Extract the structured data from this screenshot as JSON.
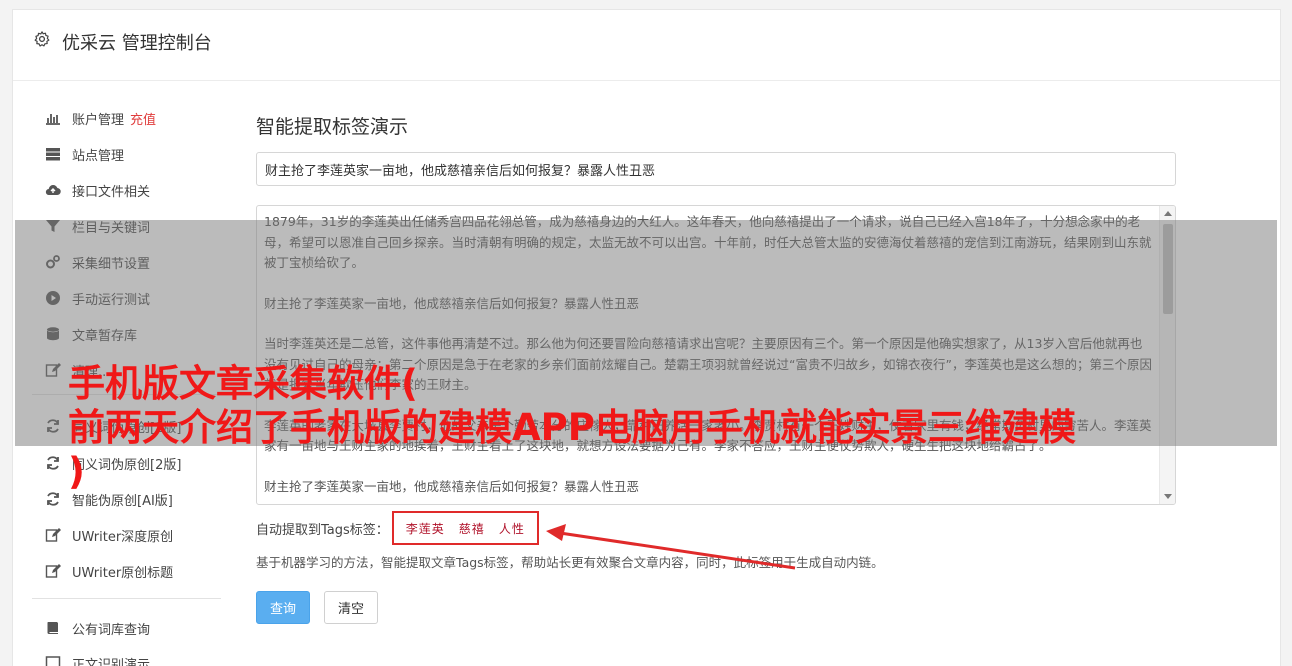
{
  "header": {
    "title": "优采云 管理控制台",
    "icon": "gear-icon"
  },
  "sidebar": {
    "items": [
      {
        "label": "账户管理",
        "badge": "充值",
        "icon": "bar-chart-icon"
      },
      {
        "label": "站点管理",
        "icon": "server-icon"
      },
      {
        "label": "接口文件相关",
        "icon": "cloud-upload-icon"
      },
      {
        "label": "栏目与关键词",
        "icon": "filter-icon"
      },
      {
        "label": "采集细节设置",
        "icon": "gears-icon"
      },
      {
        "label": "手动运行测试",
        "icon": "play-circle-icon"
      },
      {
        "label": "文章暂存库",
        "icon": "database-icon"
      },
      {
        "label": "清理...",
        "icon": "edit-icon"
      },
      {
        "label": "同义词伪原创[1版]",
        "icon": "refresh-icon"
      },
      {
        "label": "同义词伪原创[2版]",
        "icon": "refresh-icon"
      },
      {
        "label": "智能伪原创[AI版]",
        "icon": "refresh-icon"
      },
      {
        "label": "UWriter深度原创",
        "icon": "edit-icon"
      },
      {
        "label": "UWriter原创标题",
        "icon": "edit-icon"
      },
      {
        "label": "公有词库查询",
        "icon": "book-icon"
      },
      {
        "label": "正文识别演示",
        "icon": "window-icon"
      }
    ]
  },
  "main": {
    "title": "智能提取标签演示",
    "title_input_value": "财主抢了李莲英家一亩地，他成慈禧亲信后如何报复？暴露人性丑恶",
    "content_paragraphs": [
      "1879年，31岁的李莲英出任储秀宫四品花翎总管，成为慈禧身边的大红人。这年春天，他向慈禧提出了一个请求，说自己已经入宫18年了，十分想念家中的老母，希望可以恩准自己回乡探亲。当时清朝有明确的规定，太监无故不可以出宫。十年前，时任大总管太监的安德海仗着慈禧的宠信到江南游玩，结果刚到山东就被丁宝桢给砍了。",
      "财主抢了李莲英家一亩地，他成慈禧亲信后如何报复？暴露人性丑恶",
      "当时李莲英还是二总管，这件事他再清楚不过。那么他为何还要冒险向慈禧请求出宫呢？主要原因有三个。第一个原因是他确实想家了，从13岁入宫后他就再也没有见过自己的母亲；第二个原因是急于在老家的乡亲们面前炫耀自己。楚霸王项羽就曾经说过“富贵不归故乡，如锦衣夜行”，李莲英也是这么想的；第三个原因就是报复当年欺压他们李家的王财主。",
      "李莲英的老家在大城县李贾村，他的父亲是个勤劳本分的庄稼人，靠种田养活一家老小。李贾村有一个王姓财主，仗着家里有钱，经常欺负村里的穷苦人。李莲英家有一亩地与王财主家的地挨着，王财主看上了这块地，就想方设法要据为己有。李家不答应，王财主便仗势欺人，硬生生把这块地给霸占了。",
      "财主抢了李莲英家一亩地，他成慈禧亲信后如何报复？暴露人性丑恶"
    ],
    "tags_label": "自动提取到Tags标签：",
    "tags": [
      "李莲英",
      "慈禧",
      "人性"
    ],
    "description": "基于机器学习的方法，智能提取文章Tags标签，帮助站长更有效聚合文章内容，同时，此标签用于生成自动内链。",
    "query_button": "查询",
    "clear_button": "清空"
  },
  "overlay": {
    "line1": "手机版文章采集软件(",
    "line2": "前两天介绍了手机版的建模APP电脑用手机就能实景三维建模",
    "line3": ")"
  },
  "colors": {
    "accent": "#5aaef0",
    "tag_border": "#e02a2a",
    "recharge": "#e03c3c",
    "overlay_text": "#f01818"
  }
}
